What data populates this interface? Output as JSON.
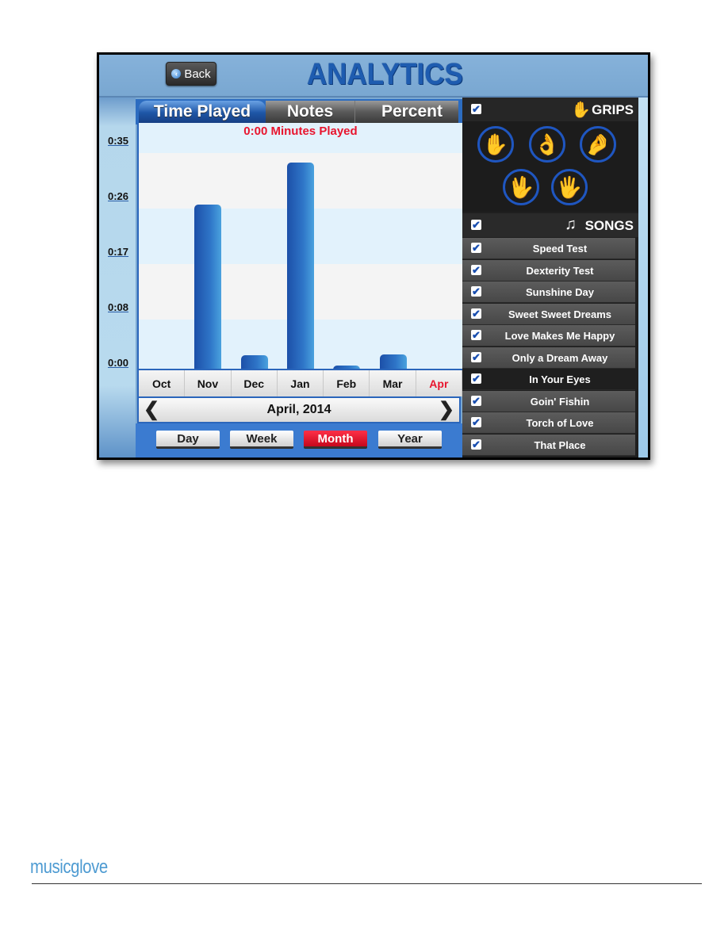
{
  "header": {
    "back_label": "Back",
    "title": "ANALYTICS"
  },
  "tabs": [
    {
      "label": "Time Played",
      "active": true
    },
    {
      "label": "Notes",
      "active": false
    },
    {
      "label": "Percent",
      "active": false
    }
  ],
  "summary": "0:00 Minutes Played",
  "navigator": {
    "label": "April, 2014",
    "prev_icon": "chevron-left-icon",
    "next_icon": "chevron-right-icon"
  },
  "periods": [
    {
      "label": "Day",
      "active": false
    },
    {
      "label": "Week",
      "active": false
    },
    {
      "label": "Month",
      "active": true
    },
    {
      "label": "Year",
      "active": false
    }
  ],
  "grips": {
    "label": "GRIPS",
    "checked": true,
    "icons": [
      "grip-flat-hand-icon",
      "grip-ok-sign-icon",
      "grip-pinch-icon",
      "grip-three-finger-icon",
      "grip-four-finger-icon"
    ]
  },
  "songs": {
    "label": "SONGS",
    "checked": true,
    "items": [
      {
        "title": "Speed Test",
        "checked": true,
        "selected": false
      },
      {
        "title": "Dexterity Test",
        "checked": true,
        "selected": false
      },
      {
        "title": "Sunshine Day",
        "checked": true,
        "selected": false
      },
      {
        "title": "Sweet Sweet Dreams",
        "checked": true,
        "selected": false
      },
      {
        "title": "Love Makes Me Happy",
        "checked": true,
        "selected": false
      },
      {
        "title": "Only a Dream Away",
        "checked": true,
        "selected": false
      },
      {
        "title": "In Your Eyes",
        "checked": true,
        "selected": true
      },
      {
        "title": "Goin' Fishin",
        "checked": true,
        "selected": false
      },
      {
        "title": "Torch of Love",
        "checked": true,
        "selected": false
      },
      {
        "title": "That Place",
        "checked": true,
        "selected": false
      }
    ]
  },
  "colors": {
    "accent_red": "#e8152e",
    "bar_blue": "#2f76c8",
    "highlight_month": "#e8152e"
  },
  "footer": {
    "brand": "musicglove"
  },
  "chart_data": {
    "type": "bar",
    "title": "0:00 Minutes Played",
    "categories": [
      "Oct",
      "Nov",
      "Dec",
      "Jan",
      "Feb",
      "Mar",
      "Apr"
    ],
    "highlighted_category": "Apr",
    "values": [
      0,
      26,
      2.3,
      32.6,
      0.6,
      2.4,
      0
    ],
    "units": "minutes",
    "yticks": [
      "0:00",
      "0:08",
      "0:17",
      "0:26",
      "0:35"
    ],
    "ytick_values": [
      0,
      8.75,
      17.5,
      26.25,
      35
    ],
    "ylim": [
      0,
      35
    ],
    "xlabel": "",
    "ylabel": "",
    "grid": true
  }
}
